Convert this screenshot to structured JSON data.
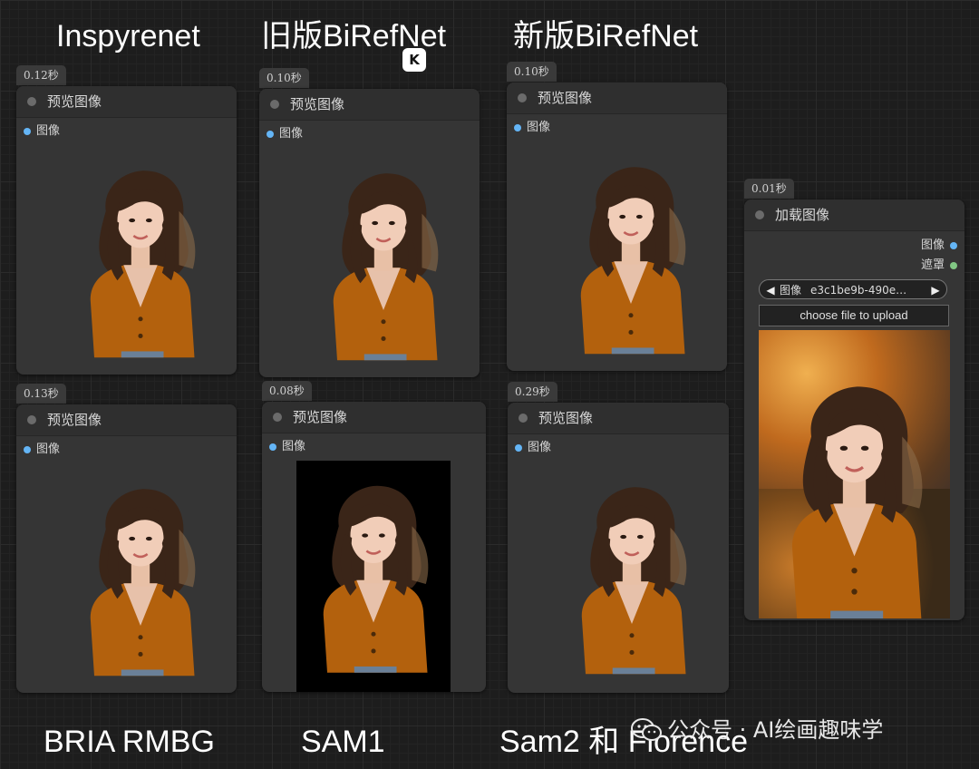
{
  "headings": {
    "inspyrenet": "Inspyrenet",
    "old_birefnet": "旧版BiRefNet",
    "new_birefnet": "新版BiRefNet"
  },
  "captions": {
    "bria": "BRIA RMBG",
    "sam1": "SAM1",
    "sam2": "Sam2 和 Florence"
  },
  "preview_nodes": [
    {
      "time": "0.12秒",
      "title": "预览图像",
      "port": "图像"
    },
    {
      "time": "0.10秒",
      "title": "预览图像",
      "port": "图像"
    },
    {
      "time": "0.10秒",
      "title": "预览图像",
      "port": "图像"
    },
    {
      "time": "0.13秒",
      "title": "预览图像",
      "port": "图像"
    },
    {
      "time": "0.08秒",
      "title": "预览图像",
      "port": "图像"
    },
    {
      "time": "0.29秒",
      "title": "预览图像",
      "port": "图像"
    }
  ],
  "load_node": {
    "time": "0.01秒",
    "title": "加载图像",
    "outputs": [
      {
        "label": "图像",
        "color": "#64b5f6"
      },
      {
        "label": "遮罩",
        "color": "#81c784"
      }
    ],
    "combo_label": "图像",
    "combo_value": "e3c1be9b-490e…",
    "upload_label": "choose file to upload"
  },
  "watermark": {
    "text": "公众号 · AI绘画趣味学",
    "icon": "wechat-icon"
  },
  "k_icon": {
    "text": "K",
    "name": "k-app-icon"
  },
  "colors": {
    "sweater": "#b3610d",
    "hair": "#3a2518",
    "skin": "#f1cdb8",
    "node_bg": "#353535",
    "port_blue": "#64b5f6",
    "port_green": "#81c784"
  }
}
